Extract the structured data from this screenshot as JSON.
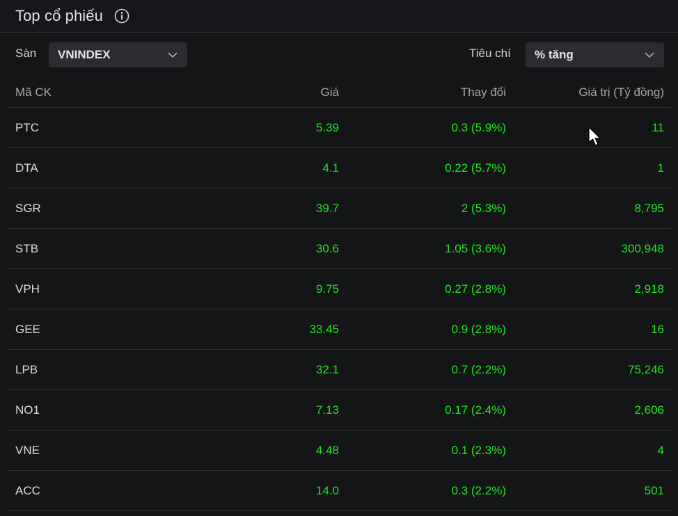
{
  "header": {
    "title": "Top cổ phiếu"
  },
  "controls": {
    "exchange_label": "Sàn",
    "exchange_value": "VNINDEX",
    "criteria_label": "Tiêu chí",
    "criteria_value": "% tăng"
  },
  "table": {
    "columns": [
      "Mã CK",
      "Giá",
      "Thay đổi",
      "Giá trị (Tỷ đồng)"
    ],
    "rows": [
      {
        "symbol": "PTC",
        "price": "5.39",
        "change": "0.3 (5.9%)",
        "value": "11"
      },
      {
        "symbol": "DTA",
        "price": "4.1",
        "change": "0.22 (5.7%)",
        "value": "1"
      },
      {
        "symbol": "SGR",
        "price": "39.7",
        "change": "2 (5.3%)",
        "value": "8,795"
      },
      {
        "symbol": "STB",
        "price": "30.6",
        "change": "1.05 (3.6%)",
        "value": "300,948"
      },
      {
        "symbol": "VPH",
        "price": "9.75",
        "change": "0.27 (2.8%)",
        "value": "2,918"
      },
      {
        "symbol": "GEE",
        "price": "33.45",
        "change": "0.9 (2.8%)",
        "value": "16"
      },
      {
        "symbol": "LPB",
        "price": "32.1",
        "change": "0.7 (2.2%)",
        "value": "75,246"
      },
      {
        "symbol": "NO1",
        "price": "7.13",
        "change": "0.17 (2.4%)",
        "value": "2,606"
      },
      {
        "symbol": "VNE",
        "price": "4.48",
        "change": "0.1 (2.3%)",
        "value": "4"
      },
      {
        "symbol": "ACC",
        "price": "14.0",
        "change": "0.3 (2.2%)",
        "value": "501"
      }
    ]
  },
  "colors": {
    "positive": "#1ee81e",
    "background": "#141517",
    "select_bg": "#2b2c2f"
  },
  "icons": {
    "info": "info-icon",
    "dropdown": "chevron-down-icon",
    "cursor": "mouse-pointer-icon"
  }
}
